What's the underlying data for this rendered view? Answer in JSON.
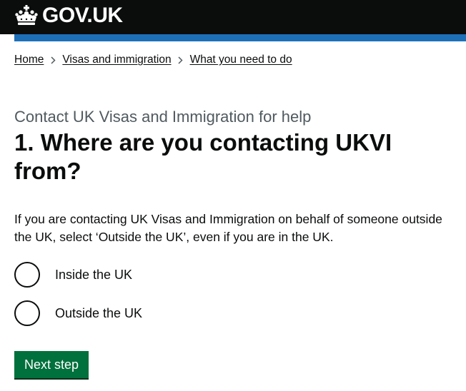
{
  "header": {
    "logo_text": "GOV.UK",
    "logo_icon": "crown-icon",
    "colors": {
      "background": "#0b0c0c",
      "accent_bar": "#1d70b8"
    }
  },
  "breadcrumbs": [
    {
      "label": "Home"
    },
    {
      "label": "Visas and immigration"
    },
    {
      "label": "What you need to do"
    }
  ],
  "caption": "Contact UK Visas and Immigration for help",
  "question": {
    "heading": "1. Where are you contacting UKVI from?",
    "hint": "If you are contacting UK Visas and Immigration on behalf of someone outside the UK, select ‘Outside the UK’, even if you are in the UK."
  },
  "options": [
    {
      "label": "Inside the UK",
      "selected": false
    },
    {
      "label": "Outside the UK",
      "selected": false
    }
  ],
  "submit": {
    "label": "Next step",
    "color": "#00703c"
  }
}
